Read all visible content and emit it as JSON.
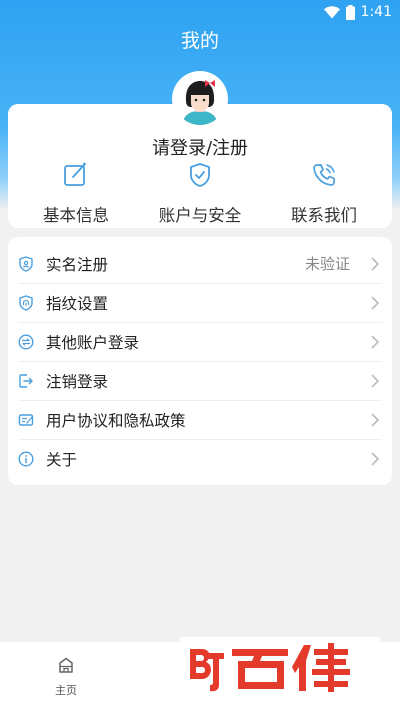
{
  "status": {
    "time": "1:41"
  },
  "header": {
    "title": "我的"
  },
  "profile": {
    "login_text": "请登录/注册"
  },
  "quick_actions": [
    {
      "label": "基本信息",
      "icon": "edit-icon"
    },
    {
      "label": "账户与安全",
      "icon": "shield-check-icon"
    },
    {
      "label": "联系我们",
      "icon": "phone-icon"
    }
  ],
  "menu": [
    {
      "label": "实名注册",
      "value": "未验证",
      "icon": "shield-id-icon"
    },
    {
      "label": "指纹设置",
      "value": "",
      "icon": "fingerprint-shield-icon"
    },
    {
      "label": "其他账户登录",
      "value": "",
      "icon": "switch-account-icon"
    },
    {
      "label": "注销登录",
      "value": "",
      "icon": "logout-icon"
    },
    {
      "label": "用户协议和隐私政策",
      "value": "",
      "icon": "agreement-icon"
    },
    {
      "label": "关于",
      "value": "",
      "icon": "info-icon"
    }
  ],
  "tabbar": {
    "home_label": "主页"
  },
  "watermark": {
    "text": "百佳"
  },
  "colors": {
    "accent": "#3a9ee8",
    "header": "#2fa2f2",
    "icon": "#4a9fe0"
  }
}
